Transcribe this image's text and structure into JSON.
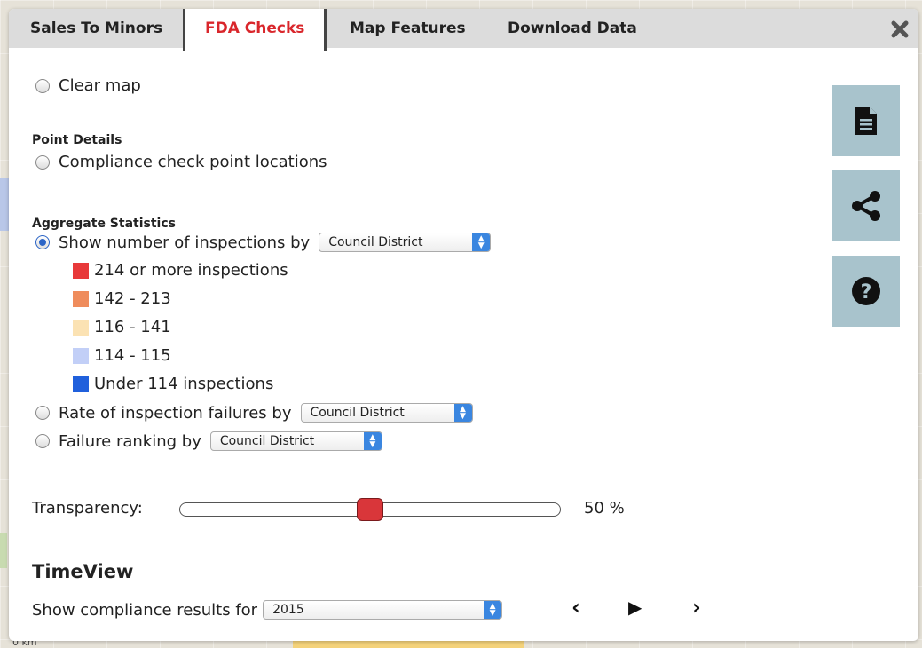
{
  "tabs": [
    {
      "label": "Sales To Minors"
    },
    {
      "label": "FDA Checks"
    },
    {
      "label": "Map Features"
    },
    {
      "label": "Download Data"
    }
  ],
  "active_tab": "FDA Checks",
  "options": {
    "clear_map": "Clear map",
    "point_details_heading": "Point Details",
    "compliance_points": "Compliance check point locations",
    "aggregate_heading": "Aggregate Statistics",
    "show_number": "Show number of inspections by",
    "rate_failures": "Rate of inspection failures by",
    "failure_ranking": "Failure ranking by",
    "selected_option": "Show number of inspections by"
  },
  "selects": {
    "number_by": "Council District",
    "rate_by": "Council District",
    "ranking_by": "Council District"
  },
  "legend": [
    {
      "label": "214 or more inspections",
      "color": "#e8393a"
    },
    {
      "label": "142 - 213",
      "color": "#ef8c5c"
    },
    {
      "label": "116 - 141",
      "color": "#fbe2b3"
    },
    {
      "label": "114 - 115",
      "color": "#c2cff7"
    },
    {
      "label": "Under 114 inspections",
      "color": "#2060dc"
    }
  ],
  "transparency": {
    "label": "Transparency:",
    "value_text": "50 %",
    "fraction": 0.5
  },
  "timeview": {
    "title": "TimeView",
    "label": "Show compliance results for",
    "year": "2015",
    "prev": "‹",
    "play": "▶",
    "next": "›"
  },
  "side_buttons": [
    {
      "icon": "document-icon"
    },
    {
      "icon": "share-icon"
    },
    {
      "icon": "help-icon"
    }
  ],
  "map": {
    "scale_text": "0 km"
  },
  "colors": {
    "accent": "#d9262b",
    "side_button": "#a8c3cc",
    "tab_bar": "#dcdcdc"
  }
}
